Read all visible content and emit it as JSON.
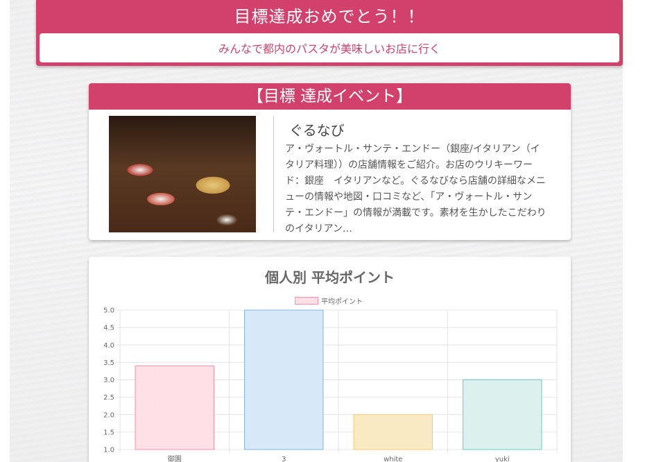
{
  "banner": {
    "title": "目標達成おめでとう！！",
    "subtitle": "みんなで都内のパスタが美味しいお店に行く"
  },
  "event": {
    "header": "【目標 達成イベント】",
    "name": "ぐるなび",
    "description": "ア・ヴォートル・サンテ・エンドー（銀座/イタリアン（イタリア料理））の店舗情報をご紹介。お店のウリキーワード：銀座　イタリアンなど。ぐるなびなら店舗の詳細なメニューの情報や地図・口コミなど、「ア・ヴォートル・サンテ・エンドー」の情報が満載です。素材を生かしたこだわりのイタリアン…"
  },
  "chart_data": {
    "type": "bar",
    "title": "個人別 平均ポイント",
    "legend": "平均ポイント",
    "legend_position": "top",
    "categories": [
      "御園",
      "3",
      "white",
      "yuki"
    ],
    "values": [
      3.4,
      5.0,
      2.0,
      3.0
    ],
    "ylim": [
      1.0,
      5.0
    ],
    "y_ticks": [
      "5.0",
      "4.5",
      "4.0",
      "3.5",
      "3.0",
      "2.5",
      "2.0",
      "1.5",
      "1.0"
    ],
    "grid": true,
    "bar_fills": [
      "#ffe0e6",
      "#d7e8f8",
      "#faeac3",
      "#dcf1ee"
    ],
    "bar_strokes": [
      "#ff8fa8",
      "#7fb6e6",
      "#f2cb72",
      "#6fc9bd"
    ]
  },
  "colors": {
    "accent": "#d1416b"
  }
}
